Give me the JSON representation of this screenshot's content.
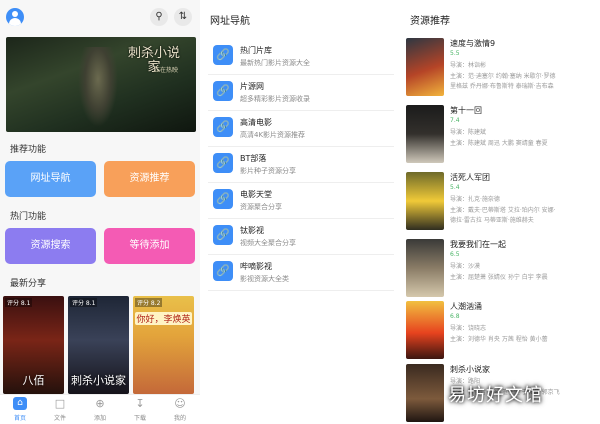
{
  "header": {
    "search_icon": "search-icon",
    "sort_icon": "sort-icon"
  },
  "banner": {
    "title": "刺杀小说家",
    "subtitle": "正在热映"
  },
  "sections": {
    "recommend": "推荐功能",
    "hot": "热门功能",
    "latest": "最新分享"
  },
  "tiles": {
    "site_nav": "网址导航",
    "resource_recommend": "资源推荐",
    "resource_search": "资源搜索",
    "coming_soon": "等待添加"
  },
  "latest_posters": [
    {
      "badge": "评分 8.1",
      "title": "八佰"
    },
    {
      "badge": "评分 8.1",
      "title": "刺杀小说家"
    },
    {
      "badge": "评分 8.2",
      "title": "你好，李焕英"
    }
  ],
  "bottom_nav": [
    {
      "label": "首页",
      "icon": "home-icon"
    },
    {
      "label": "文件",
      "icon": "folder-icon"
    },
    {
      "label": "添加",
      "icon": "plus-icon"
    },
    {
      "label": "下载",
      "icon": "download-icon"
    },
    {
      "label": "我的",
      "icon": "smile-icon"
    }
  ],
  "site_nav": {
    "title": "网址导航",
    "items": [
      {
        "name": "热门片库",
        "desc": "最新热门影片资源大全"
      },
      {
        "name": "片源网",
        "desc": "超多精彩影片资源收录"
      },
      {
        "name": "高清电影",
        "desc": "高清4K影片资源推荐"
      },
      {
        "name": "BT部落",
        "desc": "影片种子资源分享"
      },
      {
        "name": "电影天堂",
        "desc": "资源聚合分享"
      },
      {
        "name": "钛影视",
        "desc": "视频大全聚合分享"
      },
      {
        "name": "哔嘀影视",
        "desc": "影视资源大全类"
      }
    ]
  },
  "recommend": {
    "title": "资源推荐",
    "items": [
      {
        "name": "速度与激情9",
        "score": "5.5",
        "director": "导演：林诣彬",
        "cast": "主演：范·迪塞尔 约翰·塞纳 米歇尔·罗德里格兹 乔丹娜·布鲁斯特 泰瑞斯·吉布森",
        "poster_text": "F9"
      },
      {
        "name": "第十一回",
        "score": "7.4",
        "director": "导演：陈建斌",
        "cast": "主演：陈建斌 周迅 大鹏 窦靖童 春夏",
        "poster_text": "第十一回"
      },
      {
        "name": "活死人军团",
        "score": "5.4",
        "director": "导演：扎克·施奈德",
        "cast": "主演：戴夫·巴蒂斯塔 艾拉·珀内尔 安娜·德拉·雷古拉 马蒂亚斯·施维赫夫",
        "poster_text": "ARMY of the DEAD"
      },
      {
        "name": "我要我们在一起",
        "score": "6.5",
        "director": "导演：沙漠",
        "cast": "主演：屈楚萧 张婧仪 孙宁 白宇 李晨",
        "poster_text": ""
      },
      {
        "name": "人潮汹涌",
        "score": "6.8",
        "director": "导演：饶晓志",
        "cast": "主演：刘德华 肖央 万茜 程怡 黄小蕾",
        "poster_text": "人潮汹涌"
      },
      {
        "name": "刺杀小说家",
        "score": "",
        "director": "导演：路阳",
        "cast": "主演：雷佳音 杨幂 董子健 于和伟 郭京飞",
        "poster_text": ""
      }
    ]
  },
  "watermark": "易坊好文馆"
}
